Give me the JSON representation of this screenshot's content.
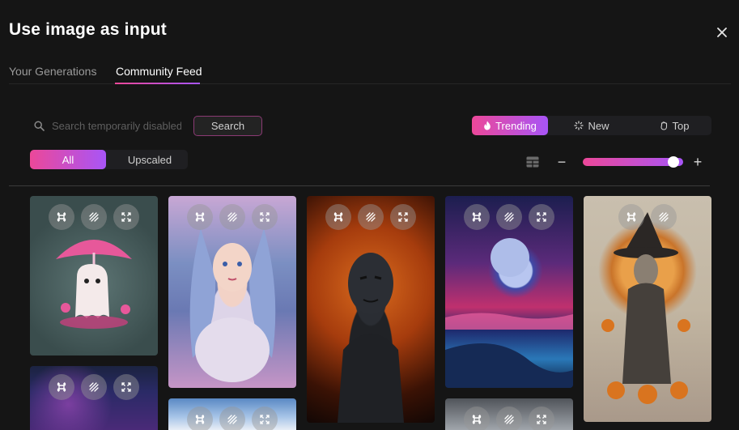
{
  "modal": {
    "title": "Use image as input",
    "close_icon": "close-icon"
  },
  "tabs": [
    {
      "label": "Your Generations",
      "active": false
    },
    {
      "label": "Community Feed",
      "active": true
    }
  ],
  "search": {
    "placeholder": "Search temporarily disabled",
    "button_label": "Search"
  },
  "sort": {
    "options": [
      {
        "label": "Trending",
        "icon": "flame-icon",
        "active": true
      },
      {
        "label": "New",
        "icon": "sparkle-icon",
        "active": false
      },
      {
        "label": "Top",
        "icon": "hand-icon",
        "active": false
      }
    ]
  },
  "filter": {
    "options": [
      {
        "label": "All",
        "active": true
      },
      {
        "label": "Upscaled",
        "active": false
      }
    ]
  },
  "grid_controls": {
    "layout_icon": "grid-layout-icon",
    "minus_label": "−",
    "plus_label": "+",
    "zoom_level": 0.95
  },
  "colors": {
    "accent_start": "#ec4899",
    "accent_end": "#a855f7",
    "background": "#151515"
  },
  "gallery": {
    "cards": [
      {
        "subject": "pink-umbrella-ghost",
        "tools": [
          "remix-icon",
          "use-image-icon",
          "expand-icon"
        ]
      },
      {
        "subject": "blue-haired-fairy",
        "tools": [
          "remix-icon",
          "use-image-icon",
          "expand-icon"
        ]
      },
      {
        "subject": "fire-statue-face",
        "tools": [
          "remix-icon",
          "use-image-icon",
          "expand-icon"
        ]
      },
      {
        "subject": "moonlit-beach",
        "tools": [
          "remix-icon",
          "use-image-icon",
          "expand-icon"
        ]
      },
      {
        "subject": "witch-with-pumpkins",
        "tools": [
          "remix-icon",
          "use-image-icon"
        ]
      },
      {
        "subject": "space-ship-nebula",
        "tools": [
          "remix-icon",
          "use-image-icon",
          "expand-icon"
        ]
      },
      {
        "subject": "sky-clouds",
        "tools": [
          "remix-icon",
          "use-image-icon",
          "expand-icon"
        ]
      },
      {
        "subject": "grey-scene",
        "tools": [
          "remix-icon",
          "use-image-icon",
          "expand-icon"
        ]
      }
    ]
  }
}
